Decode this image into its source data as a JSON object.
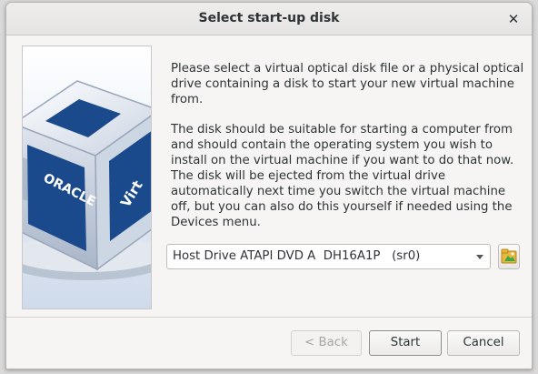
{
  "window": {
    "title": "Select start-up disk",
    "close_glyph": "✕"
  },
  "banner": {
    "logo_text": "ORACLE",
    "side_text": "Virt"
  },
  "description": {
    "paragraph1": "Please select a virtual optical disk file or a physical optical drive containing a disk to start your new virtual machine from.",
    "paragraph2": "The disk should be suitable for starting a computer from and should contain the operating system you wish to install on the virtual machine if you want to do that now. The disk will be ejected from the virtual drive automatically next time you switch the virtual machine off, but you can also do this yourself if needed using the Devices menu."
  },
  "disk_selector": {
    "selected": "Host Drive ATAPI DVD A  DH16A1P   (sr0)"
  },
  "buttons": {
    "back": "< Back",
    "start": "Start",
    "cancel": "Cancel"
  },
  "colors": {
    "accent_blue": "#1b4a8c",
    "folder_yellow": "#e8b83a",
    "folder_green": "#3aa84a"
  }
}
